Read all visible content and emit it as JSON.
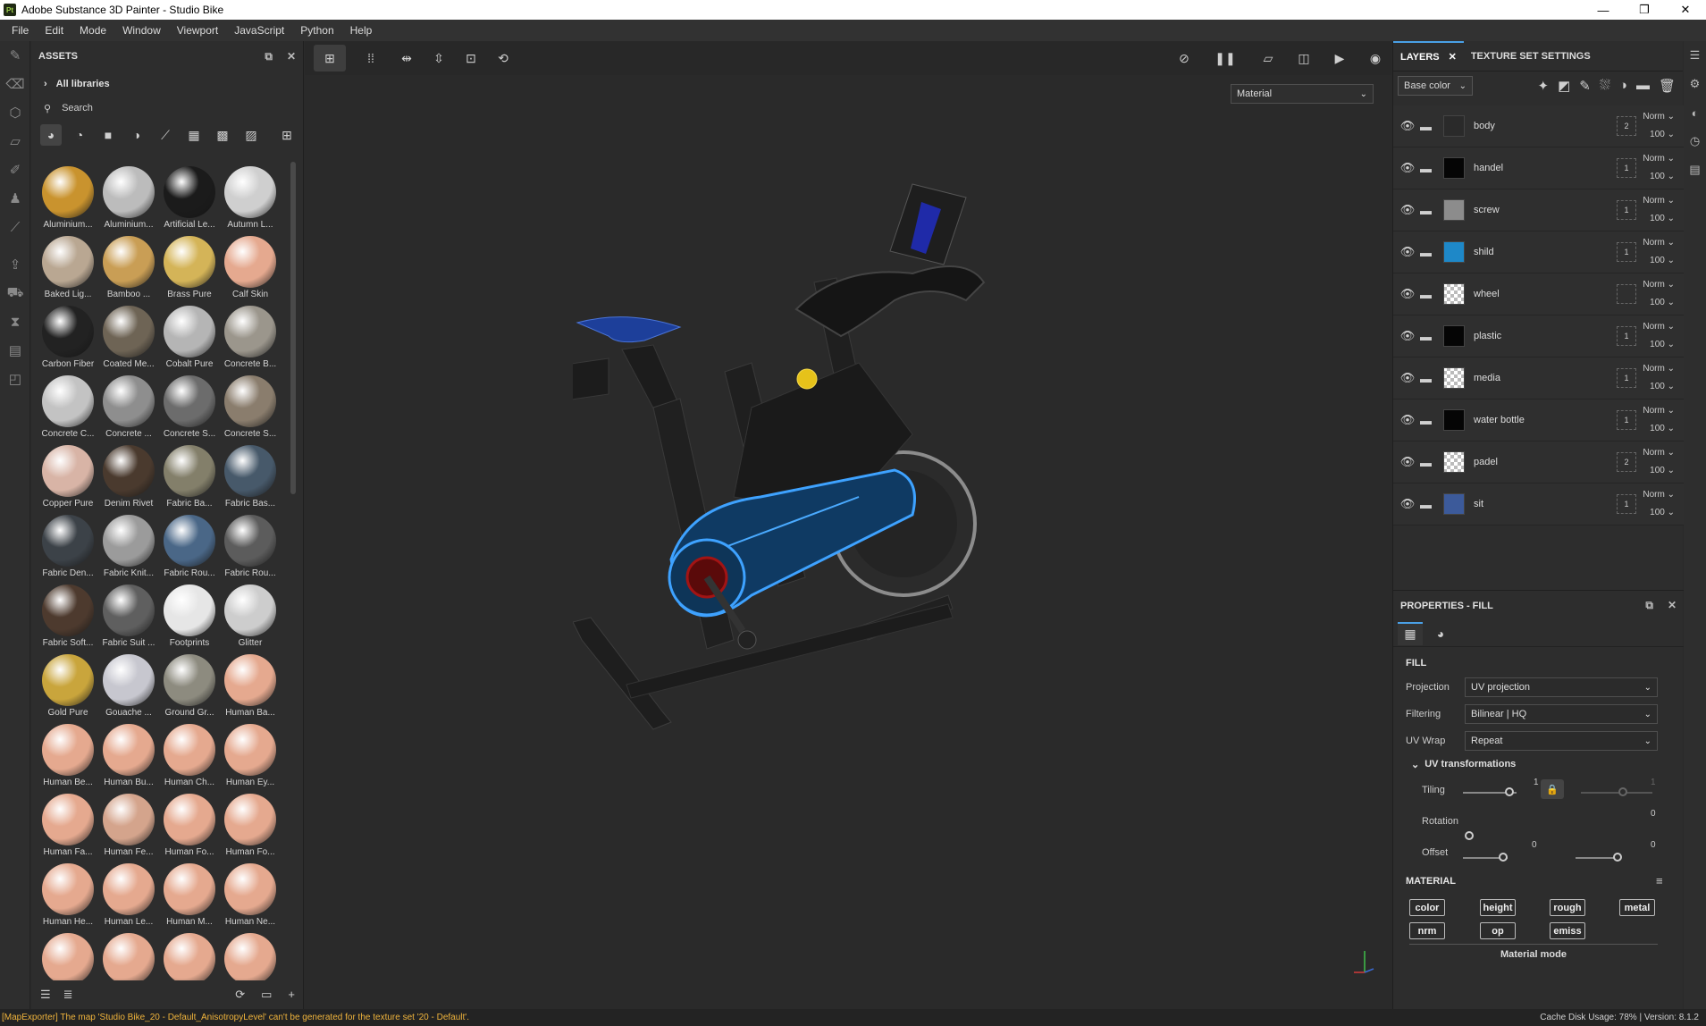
{
  "window": {
    "title": "Adobe Substance 3D Painter - Studio Bike",
    "app_icon": "Pt",
    "controls": [
      "—",
      "❐",
      "✕"
    ]
  },
  "menu": [
    "File",
    "Edit",
    "Mode",
    "Window",
    "Viewport",
    "JavaScript",
    "Python",
    "Help"
  ],
  "assets": {
    "title": "ASSETS",
    "libraries_label": "All libraries",
    "search_placeholder": "Search",
    "items": [
      {
        "label": "Aluminium...",
        "color": "#c9932e"
      },
      {
        "label": "Aluminium...",
        "color": "#bcbcbc"
      },
      {
        "label": "Artificial Le...",
        "color": "#1b1b1b"
      },
      {
        "label": "Autumn L...",
        "color": "#cfcfcf"
      },
      {
        "label": "Baked Lig...",
        "color": "#b9a792"
      },
      {
        "label": "Bamboo ...",
        "color": "#c99e55"
      },
      {
        "label": "Brass Pure",
        "color": "#d4b458"
      },
      {
        "label": "Calf Skin",
        "color": "#e5a98f"
      },
      {
        "label": "Carbon Fiber",
        "color": "#222222"
      },
      {
        "label": "Coated Me...",
        "color": "#6e6455"
      },
      {
        "label": "Cobalt Pure",
        "color": "#b5b5b5"
      },
      {
        "label": "Concrete B...",
        "color": "#9b968c"
      },
      {
        "label": "Concrete C...",
        "color": "#c3c3c3"
      },
      {
        "label": "Concrete ...",
        "color": "#8e8e8e"
      },
      {
        "label": "Concrete S...",
        "color": "#6c6c6c"
      },
      {
        "label": "Concrete S...",
        "color": "#8a7d6d"
      },
      {
        "label": "Copper Pure",
        "color": "#d8b4a6"
      },
      {
        "label": "Denim Rivet",
        "color": "#4a3a2e"
      },
      {
        "label": "Fabric Ba...",
        "color": "#837f6a"
      },
      {
        "label": "Fabric Bas...",
        "color": "#47596a"
      },
      {
        "label": "Fabric Den...",
        "color": "#3c4248"
      },
      {
        "label": "Fabric Knit...",
        "color": "#9b9b9b"
      },
      {
        "label": "Fabric Rou...",
        "color": "#4a6787"
      },
      {
        "label": "Fabric Rou...",
        "color": "#5c5c5c"
      },
      {
        "label": "Fabric Soft...",
        "color": "#4d3a2e"
      },
      {
        "label": "Fabric Suit ...",
        "color": "#5f5f5f"
      },
      {
        "label": "Footprints",
        "color": "#e6e6e6"
      },
      {
        "label": "Glitter",
        "color": "#cdcdcd"
      },
      {
        "label": "Gold Pure",
        "color": "#c9a53c"
      },
      {
        "label": "Gouache ...",
        "color": "#c7c7cf"
      },
      {
        "label": "Ground Gr...",
        "color": "#8d8b7f"
      },
      {
        "label": "Human Ba...",
        "color": "#e5a98f"
      },
      {
        "label": "Human Be...",
        "color": "#e5a98f"
      },
      {
        "label": "Human Bu...",
        "color": "#e5a98f"
      },
      {
        "label": "Human Ch...",
        "color": "#e5a98f"
      },
      {
        "label": "Human Ey...",
        "color": "#e5a98f"
      },
      {
        "label": "Human Fa...",
        "color": "#e5a98f"
      },
      {
        "label": "Human Fe...",
        "color": "#d4a48c"
      },
      {
        "label": "Human Fo...",
        "color": "#e5a98f"
      },
      {
        "label": "Human Fo...",
        "color": "#e5a98f"
      },
      {
        "label": "Human He...",
        "color": "#e5a98f"
      },
      {
        "label": "Human Le...",
        "color": "#e5a98f"
      },
      {
        "label": "Human M...",
        "color": "#e5a98f"
      },
      {
        "label": "Human Ne...",
        "color": "#e5a98f"
      },
      {
        "label": "",
        "color": "#e5a98f"
      },
      {
        "label": "",
        "color": "#e5a98f"
      },
      {
        "label": "",
        "color": "#e5a98f"
      },
      {
        "label": "",
        "color": "#e5a98f"
      }
    ]
  },
  "viewport": {
    "material_dropdown": "Material"
  },
  "layers_panel": {
    "tab_layers": "LAYERS",
    "tab_texture_set": "TEXTURE SET SETTINGS",
    "channel": "Base color",
    "layers": [
      {
        "name": "body",
        "thumb": "#2a2a2a",
        "checker": false,
        "mask_count": "2",
        "blend": "Norm",
        "opacity": "100"
      },
      {
        "name": "handel",
        "thumb": "#050505",
        "checker": false,
        "mask_count": "1",
        "blend": "Norm",
        "opacity": "100"
      },
      {
        "name": "screw",
        "thumb": "#8c8c8c",
        "checker": false,
        "mask_count": "1",
        "blend": "Norm",
        "opacity": "100"
      },
      {
        "name": "shild",
        "thumb": "#1e88c8",
        "checker": false,
        "mask_count": "1",
        "blend": "Norm",
        "opacity": "100"
      },
      {
        "name": "wheel",
        "thumb": "",
        "checker": true,
        "mask_count": "",
        "blend": "Norm",
        "opacity": "100"
      },
      {
        "name": "plastic",
        "thumb": "#050505",
        "checker": false,
        "mask_count": "1",
        "blend": "Norm",
        "opacity": "100"
      },
      {
        "name": "media",
        "thumb": "",
        "checker": true,
        "mask_count": "1",
        "blend": "Norm",
        "opacity": "100"
      },
      {
        "name": "water bottle",
        "thumb": "#050505",
        "checker": false,
        "mask_count": "1",
        "blend": "Norm",
        "opacity": "100"
      },
      {
        "name": "padel",
        "thumb": "",
        "checker": true,
        "mask_count": "2",
        "blend": "Norm",
        "opacity": "100"
      },
      {
        "name": "sit",
        "thumb": "#3c5a9a",
        "checker": false,
        "mask_count": "1",
        "blend": "Norm",
        "opacity": "100"
      }
    ]
  },
  "properties": {
    "title": "PROPERTIES - FILL",
    "fill_title": "FILL",
    "projection_label": "Projection",
    "projection_value": "UV projection",
    "filtering_label": "Filtering",
    "filtering_value": "Bilinear | HQ",
    "uvwrap_label": "UV Wrap",
    "uvwrap_value": "Repeat",
    "uv_transformations": "UV transformations",
    "tiling_label": "Tiling",
    "tiling_value": "1",
    "tiling_value2": "1",
    "rotation_label": "Rotation",
    "rotation_value": "0",
    "offset_label": "Offset",
    "offset_value1": "0",
    "offset_value2": "0",
    "material_title": "MATERIAL",
    "channels": [
      "color",
      "height",
      "rough",
      "metal",
      "nrm",
      "op",
      "emiss"
    ],
    "material_mode": "Material mode"
  },
  "status": {
    "message": "[MapExporter] The map 'Studio Bike_20 - Default_AnisotropyLevel' can't be generated for the texture set '20 - Default'.",
    "right": "Cache Disk Usage:   78% | Version: 8.1.2"
  }
}
